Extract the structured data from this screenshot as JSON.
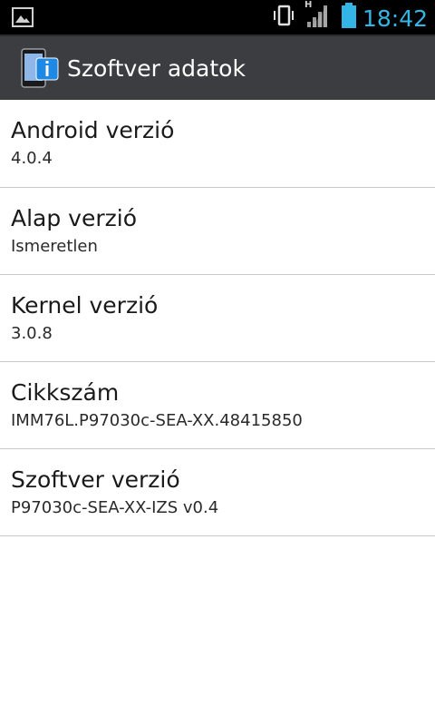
{
  "status_bar": {
    "time": "18:42",
    "network_type": "H",
    "colors": {
      "time": "#33b5e5",
      "background": "#000000"
    },
    "icons": [
      "gallery-notification-icon",
      "vibrate-icon",
      "hspa-signal-icon",
      "battery-icon"
    ]
  },
  "action_bar": {
    "title": "Szoftver adatok",
    "icon": "phone-info-icon",
    "colors": {
      "background": "#3c3d40",
      "title": "#ffffff",
      "icon_accent": "#1e88e5"
    }
  },
  "items": [
    {
      "title": "Android verzió",
      "value": "4.0.4"
    },
    {
      "title": "Alap verzió",
      "value": "Ismeretlen"
    },
    {
      "title": "Kernel verzió",
      "value": "3.0.8"
    },
    {
      "title": "Cikkszám",
      "value": "IMM76L.P97030c-SEA-XX.48415850"
    },
    {
      "title": "Szoftver verzió",
      "value": "P97030c-SEA-XX-IZS v0.4"
    }
  ]
}
